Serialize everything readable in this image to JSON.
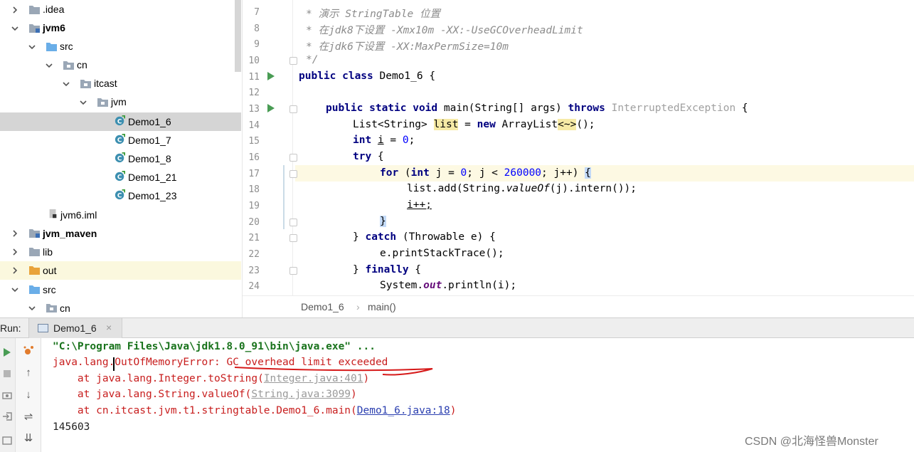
{
  "project_tree": {
    "items": [
      {
        "label": ".idea",
        "expanded": false,
        "icon": "folder-icon"
      },
      {
        "label": "jvm6",
        "expanded": true,
        "icon": "module-folder-icon"
      },
      {
        "label": "src",
        "expanded": true,
        "icon": "source-folder-icon"
      },
      {
        "label": "cn",
        "expanded": true,
        "icon": "package-icon"
      },
      {
        "label": "itcast",
        "expanded": true,
        "icon": "package-icon"
      },
      {
        "label": "jvm",
        "expanded": true,
        "icon": "package-icon"
      },
      {
        "label": "Demo1_6",
        "icon": "java-class-icon",
        "selected": true
      },
      {
        "label": "Demo1_7",
        "icon": "java-class-icon"
      },
      {
        "label": "Demo1_8",
        "icon": "java-class-icon"
      },
      {
        "label": "Demo1_21",
        "icon": "java-class-icon"
      },
      {
        "label": "Demo1_23",
        "icon": "java-class-icon"
      },
      {
        "label": "jvm6.iml",
        "icon": "iml-file-icon"
      },
      {
        "label": "jvm_maven",
        "expanded": false,
        "icon": "module-folder-icon"
      },
      {
        "label": "lib",
        "expanded": false,
        "icon": "folder-icon"
      },
      {
        "label": "out",
        "expanded": false,
        "icon": "excluded-folder-icon"
      },
      {
        "label": "src",
        "expanded": true,
        "icon": "source-folder-icon"
      },
      {
        "label": "cn",
        "expanded": true,
        "icon": "package-icon"
      }
    ]
  },
  "editor": {
    "line_numbers": [
      "7",
      "8",
      "9",
      "10",
      "11",
      "12",
      "13",
      "14",
      "15",
      "16",
      "17",
      "18",
      "19",
      "20",
      "21",
      "22",
      "23",
      "24"
    ],
    "current_line": "17",
    "lines": {
      "l7": "* 演示 StringTable 位置",
      "l8": "* 在jdk8下设置 -Xmx10m -XX:-UseGCOverheadLimit",
      "l9": "* 在jdk6下设置 -XX:MaxPermSize=10m",
      "l10": "*/",
      "l11_kw": "public class",
      "l11_rest": " Demo1_6 {",
      "l13_kw1": "public static void",
      "l13_mid": " main(String[] args) ",
      "l13_kw2": "throws",
      "l13_exc": " InterruptedException",
      "l13_end": " {",
      "l14_a": "List<String> ",
      "l14_var": "list",
      "l14_b": " = ",
      "l14_kw": "new",
      "l14_c": " ArrayList",
      "l14_diamond": "<~>",
      "l14_d": "();",
      "l15_kw": "int",
      "l15_var": "i",
      "l15_b": " = ",
      "l15_num": "0",
      "l15_c": ";",
      "l16_kw": "try",
      "l16_b": " {",
      "l17_kw1": "for",
      "l17_b": " (",
      "l17_kw2": "int",
      "l17_c": " j = ",
      "l17_n1": "0",
      "l17_d": "; j < ",
      "l17_n2": "260000",
      "l17_e": "; j++) ",
      "l17_brace": "{",
      "l18_a": "list.add(String.",
      "l18_it": "valueOf",
      "l18_b": "(j).intern());",
      "l19": "i++;",
      "l20_brace": "}",
      "l21_a": "} ",
      "l21_kw": "catch",
      "l21_b": " (Throwable e) {",
      "l22": "e.printStackTrace();",
      "l23_a": "} ",
      "l23_kw": "finally",
      "l23_b": " {",
      "l24_a": "System.",
      "l24_field": "out",
      "l24_b": ".println(i);"
    }
  },
  "breadcrumb": {
    "file": "Demo1_6",
    "separator": "›",
    "method": "main()"
  },
  "run_panel": {
    "label": "Run:",
    "tab_label": "Demo1_6",
    "tab_close": "×",
    "console": {
      "command": "\"C:\\Program Files\\Java\\jdk1.8.0_91\\bin\\java.exe\" ...",
      "error_prefix": "java.lang.OutOfMemoryError: ",
      "error_message": "GC overhead limit exceeded",
      "trace1_prefix": "    at java.lang.Integer.toString(",
      "trace1_link": "Integer.java:401",
      "trace1_suffix": ")",
      "trace2_prefix": "    at java.lang.String.valueOf(",
      "trace2_link": "String.java:3099",
      "trace2_suffix": ")",
      "trace3_prefix": "    at cn.itcast.jvm.t1.stringtable.Demo1_6.main(",
      "trace3_link": "Demo1_6.java:18",
      "trace3_suffix": ")",
      "output": "145603"
    }
  },
  "watermark": "CSDN @北海怪兽Monster",
  "colors": {
    "keyword": "#000080",
    "comment": "#8c8c8c",
    "number": "#0000ff",
    "error": "#c81e1e",
    "link": "#2b3fb0",
    "run_green": "#499c54"
  }
}
